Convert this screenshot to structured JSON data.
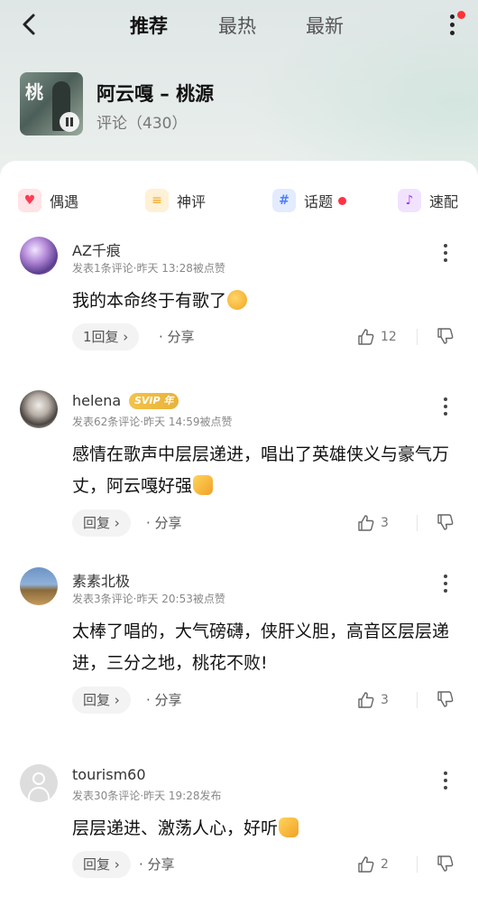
{
  "header": {
    "tabs": [
      {
        "label": "推荐",
        "active": true
      },
      {
        "label": "最热",
        "active": false
      },
      {
        "label": "最新",
        "active": false
      }
    ],
    "back_icon": "chevron-left-icon",
    "more_icon": "more-vertical-icon",
    "notification_dot_color": "#ff3333"
  },
  "song": {
    "title": "阿云嘎 – 桃源",
    "comment_count_label": "评论（430）",
    "cover_glyph": "桃"
  },
  "categories": [
    {
      "label": "偶遇",
      "icon": "heart-icon",
      "glyph": "♥",
      "color": "#ff3b54"
    },
    {
      "label": "神评",
      "icon": "quote-icon",
      "glyph": "≡",
      "color": "#f3a51e"
    },
    {
      "label": "话题",
      "icon": "hash-icon",
      "glyph": "#",
      "color": "#4c7cff",
      "has_dot": true
    },
    {
      "label": "速配",
      "icon": "music-note-icon",
      "glyph": "♪",
      "color": "#a23be6"
    }
  ],
  "comments": [
    {
      "username": "AZ千痕",
      "meta": "发表1条评论·昨天 13:28被点赞",
      "text": "我的本命终于有歌了",
      "emoji": "kiss-emoji",
      "reply_label": "1回复 ›",
      "share_label": "· 分享",
      "likes": "12"
    },
    {
      "username": "helena",
      "badge": "SVIP 年",
      "meta": "发表62条评论·昨天 14:59被点赞",
      "text": "感情在歌声中层层递进，唱出了英雄侠义与豪气万丈，阿云嘎好强",
      "emoji": "thumbs-up-emoji",
      "reply_label": "回复 ›",
      "share_label": "· 分享",
      "likes": "3"
    },
    {
      "username": "素素北极",
      "meta": "发表3条评论·昨天 20:53被点赞",
      "text": "太棒了唱的，大气磅礴，侠肝义胆，高音区层层递进，三分之地，桃花不败!",
      "reply_label": "回复 ›",
      "share_label": "· 分享",
      "likes": "3"
    },
    {
      "username": "tourism60",
      "meta": "发表30条评论·昨天 19:28发布",
      "text": "层层递进、激荡人心，好听",
      "emoji": "thumbs-up-emoji",
      "reply_label": "回复 ›",
      "share_label": "· 分享",
      "likes": "2"
    }
  ]
}
